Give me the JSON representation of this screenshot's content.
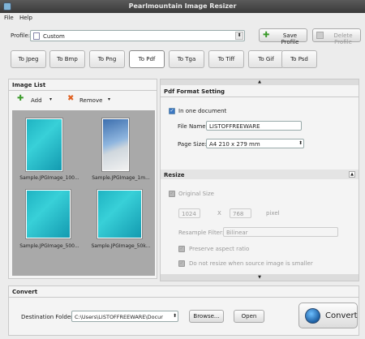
{
  "window": {
    "title": "Pearlmountain Image Resizer"
  },
  "menu": {
    "file": "File",
    "help": "Help"
  },
  "profile": {
    "label": "Profile:",
    "value": "Custom",
    "save_label": "Save Profile",
    "delete_label": "Delete Profile"
  },
  "formats": [
    "To Jpeg",
    "To Bmp",
    "To Png",
    "To Pdf",
    "To Tga",
    "To Tiff",
    "To Gif",
    "To Psd"
  ],
  "active_format": "To Pdf",
  "image_list": {
    "title": "Image List",
    "add_label": "Add",
    "remove_label": "Remove",
    "items": [
      "Sample.JPGImage_100...",
      "Sample.JPGImage_1m...",
      "Sample.JPGImage_500...",
      "Sample.JPGImage_50k..."
    ]
  },
  "pdf": {
    "title": "Pdf Format Setting",
    "one_doc_label": "In one document",
    "file_name_label": "File Name:",
    "file_name_value": "LISTOFFREEWARE",
    "page_size_label": "Page Size:",
    "page_size_value": "A4 210 x 279 mm"
  },
  "resize": {
    "title": "Resize",
    "original_size_label": "Original Size",
    "width": "1024",
    "height": "768",
    "x_label": "X",
    "unit": "pixel",
    "filter_label": "Resample Filter:",
    "filter_value": "Bilinear",
    "aspect_label": "Preserve aspect ratio",
    "no_enlarge_label": "Do not resize when source image is smaller"
  },
  "convert": {
    "title": "Convert",
    "dest_label": "Destination Folder:",
    "dest_value": "C:\\Users\\LISTOFFREEWARE\\Docur",
    "browse_label": "Browse...",
    "open_label": "Open",
    "convert_label": "Convert"
  },
  "colors": {
    "accent": "#3a77c2",
    "thumb": "#1fb3c2"
  }
}
